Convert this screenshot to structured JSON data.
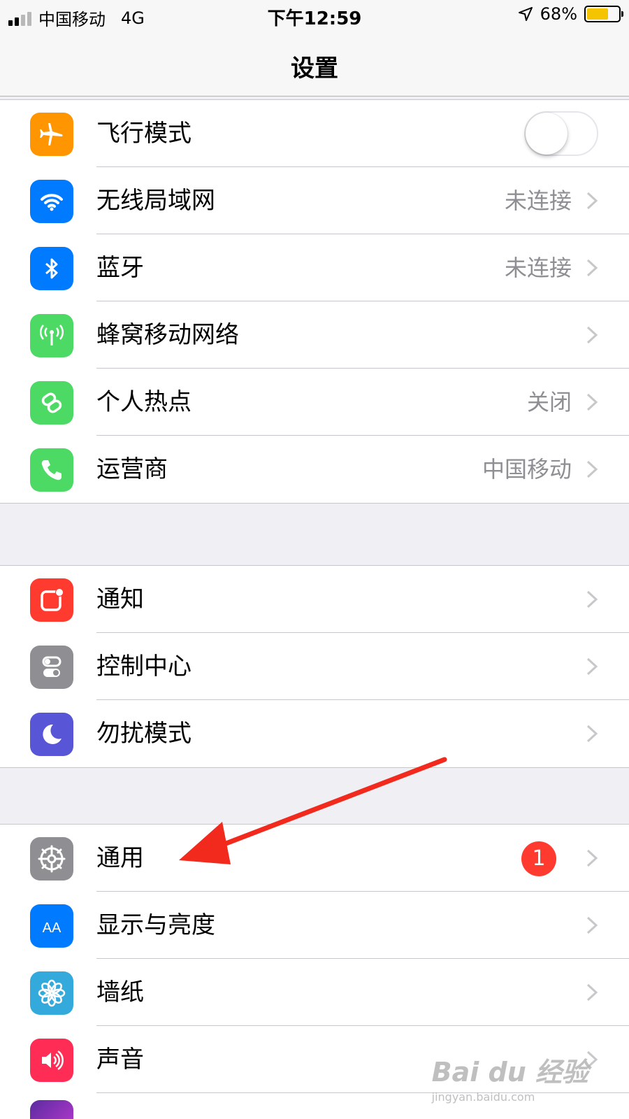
{
  "status_bar": {
    "carrier": "中国移动",
    "network": "4G",
    "time": "下午12:59",
    "battery_percent": "68%",
    "battery_level": 0.68
  },
  "nav": {
    "title": "设置"
  },
  "group1": [
    {
      "label": "飞行模式",
      "icon": "airplane-icon",
      "color": "#ff9500",
      "toggle": false
    },
    {
      "label": "无线局域网",
      "icon": "wifi-icon",
      "color": "#007aff",
      "detail": "未连接"
    },
    {
      "label": "蓝牙",
      "icon": "bluetooth-icon",
      "color": "#007aff",
      "detail": "未连接"
    },
    {
      "label": "蜂窝移动网络",
      "icon": "cellular-icon",
      "color": "#4cd964",
      "detail": ""
    },
    {
      "label": "个人热点",
      "icon": "hotspot-icon",
      "color": "#4cd964",
      "detail": "关闭"
    },
    {
      "label": "运营商",
      "icon": "phone-icon",
      "color": "#4cd964",
      "detail": "中国移动"
    }
  ],
  "group2": [
    {
      "label": "通知",
      "icon": "notification-icon",
      "color": "#ff3b30"
    },
    {
      "label": "控制中心",
      "icon": "control-center-icon",
      "color": "#8e8e93"
    },
    {
      "label": "勿扰模式",
      "icon": "moon-icon",
      "color": "#5856d6"
    }
  ],
  "group3": [
    {
      "label": "通用",
      "icon": "gear-icon",
      "color": "#8e8e93",
      "badge": "1"
    },
    {
      "label": "显示与亮度",
      "icon": "text-size-icon",
      "color": "#007aff"
    },
    {
      "label": "墙纸",
      "icon": "flower-icon",
      "color": "#34aadc"
    },
    {
      "label": "声音",
      "icon": "speaker-icon",
      "color": "#ff2d55"
    }
  ],
  "icon_glyphs": {
    "text_size": "AA"
  },
  "watermark": {
    "main": "Bai du 经验",
    "sub": "jingyan.baidu.com"
  }
}
